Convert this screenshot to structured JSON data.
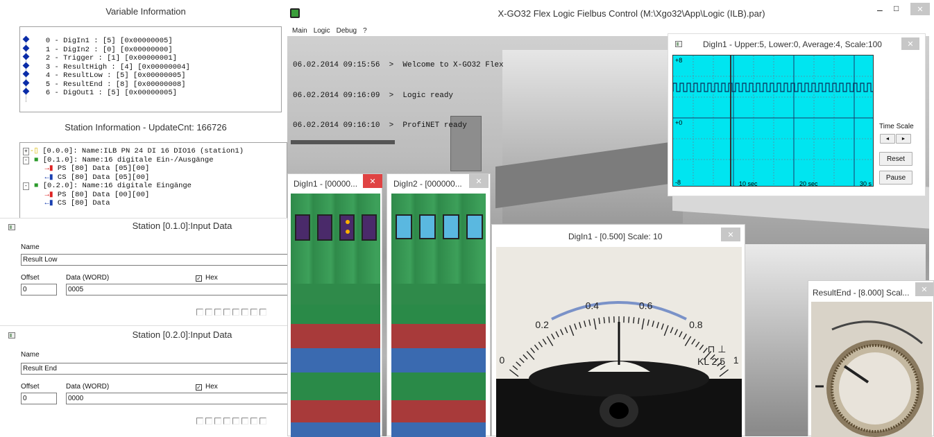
{
  "variable_panel": {
    "title": "Variable Information",
    "items": [
      "0 - DigIn1 : [5] [0x00000005]",
      "1 - DigIn2 : [0] [0x00000000]",
      "2 - Trigger : [1] [0x00000001]",
      "3 - ResultHigh : [4] [0x00000004]",
      "4 - ResultLow : [5] [0x00000005]",
      "5 - ResultEnd : [8] [0x00000008]",
      "6 - DigOut1 : [5] [0x00000005]"
    ]
  },
  "station_panel": {
    "title": "Station Information - UpdateCnt: 166726",
    "tree": [
      "[0.0.0]: Name:ILB PN 24 DI 16 DIO16 (station1)",
      "[0.1.0]: Name:16 digitale Ein-/Ausgänge",
      "PS [80] Data [05][00]",
      "CS [80] Data [05][00]",
      "[0.2.0]: Name:16 digitale Eingänge",
      "PS [80] Data [00][00]",
      "CS [80] Data"
    ]
  },
  "input1": {
    "title": "Station [0.1.0]:Input Data",
    "name_label": "Name",
    "name_value": "Result Low",
    "offset_label": "Offset",
    "offset_value": "0",
    "data_label": "Data (WORD)",
    "data_value": "0005",
    "hex_label": "Hex",
    "hex_checked": true
  },
  "input2": {
    "title": "Station [0.2.0]:Input Data",
    "name_label": "Name",
    "name_value": "Result End",
    "offset_label": "Offset",
    "offset_value": "0",
    "data_label": "Data (WORD)",
    "data_value": "0000",
    "hex_label": "Hex",
    "hex_checked": true
  },
  "main_window": {
    "title": "X-GO32 Flex Logic Fielbus Control (M:\\Xgo32\\App\\Logic (ILB).par)",
    "menu": [
      "Main",
      "Logic",
      "Debug",
      "?"
    ],
    "log": [
      "06.02.2014 09:15:56  >  Welcome to X-GO32 Flex",
      "06.02.2014 09:16:09  >  Logic ready",
      "06.02.2014 09:16:10  >  ProfiNET ready"
    ],
    "controls": {
      "minimize": "–",
      "maximize": "□",
      "close": "✕"
    }
  },
  "scope": {
    "title": "DigIn1 - Upper:5, Lower:0, Average:4, Scale:100",
    "y_labels": [
      "+8",
      "+0",
      "-8"
    ],
    "x_labels": [
      "10 sec",
      "20 sec",
      "30 s"
    ],
    "time_scale_label": "Time Scale",
    "left_arrow": "◄",
    "right_arrow": "►",
    "reset_label": "Reset",
    "pause_label": "Pause",
    "colors": {
      "background": "#00e5f0",
      "signal": "#0b2f5a"
    }
  },
  "digin1_window": {
    "title": "DigIn1 - [00000...",
    "close": "✕"
  },
  "digin2_window": {
    "title": "DigIn2 - [000000...",
    "close": "✕"
  },
  "meter_window": {
    "title": "DigIn1 - [0.500] Scale: 10",
    "close": "✕",
    "scale_labels": [
      "0",
      "0.2",
      "0.4",
      "0.6",
      "0.8",
      "1"
    ],
    "value": 0.5,
    "marking": "KL 2.5"
  },
  "knob_window": {
    "title": "ResultEnd - [8.000] Scal...",
    "close": "✕"
  }
}
